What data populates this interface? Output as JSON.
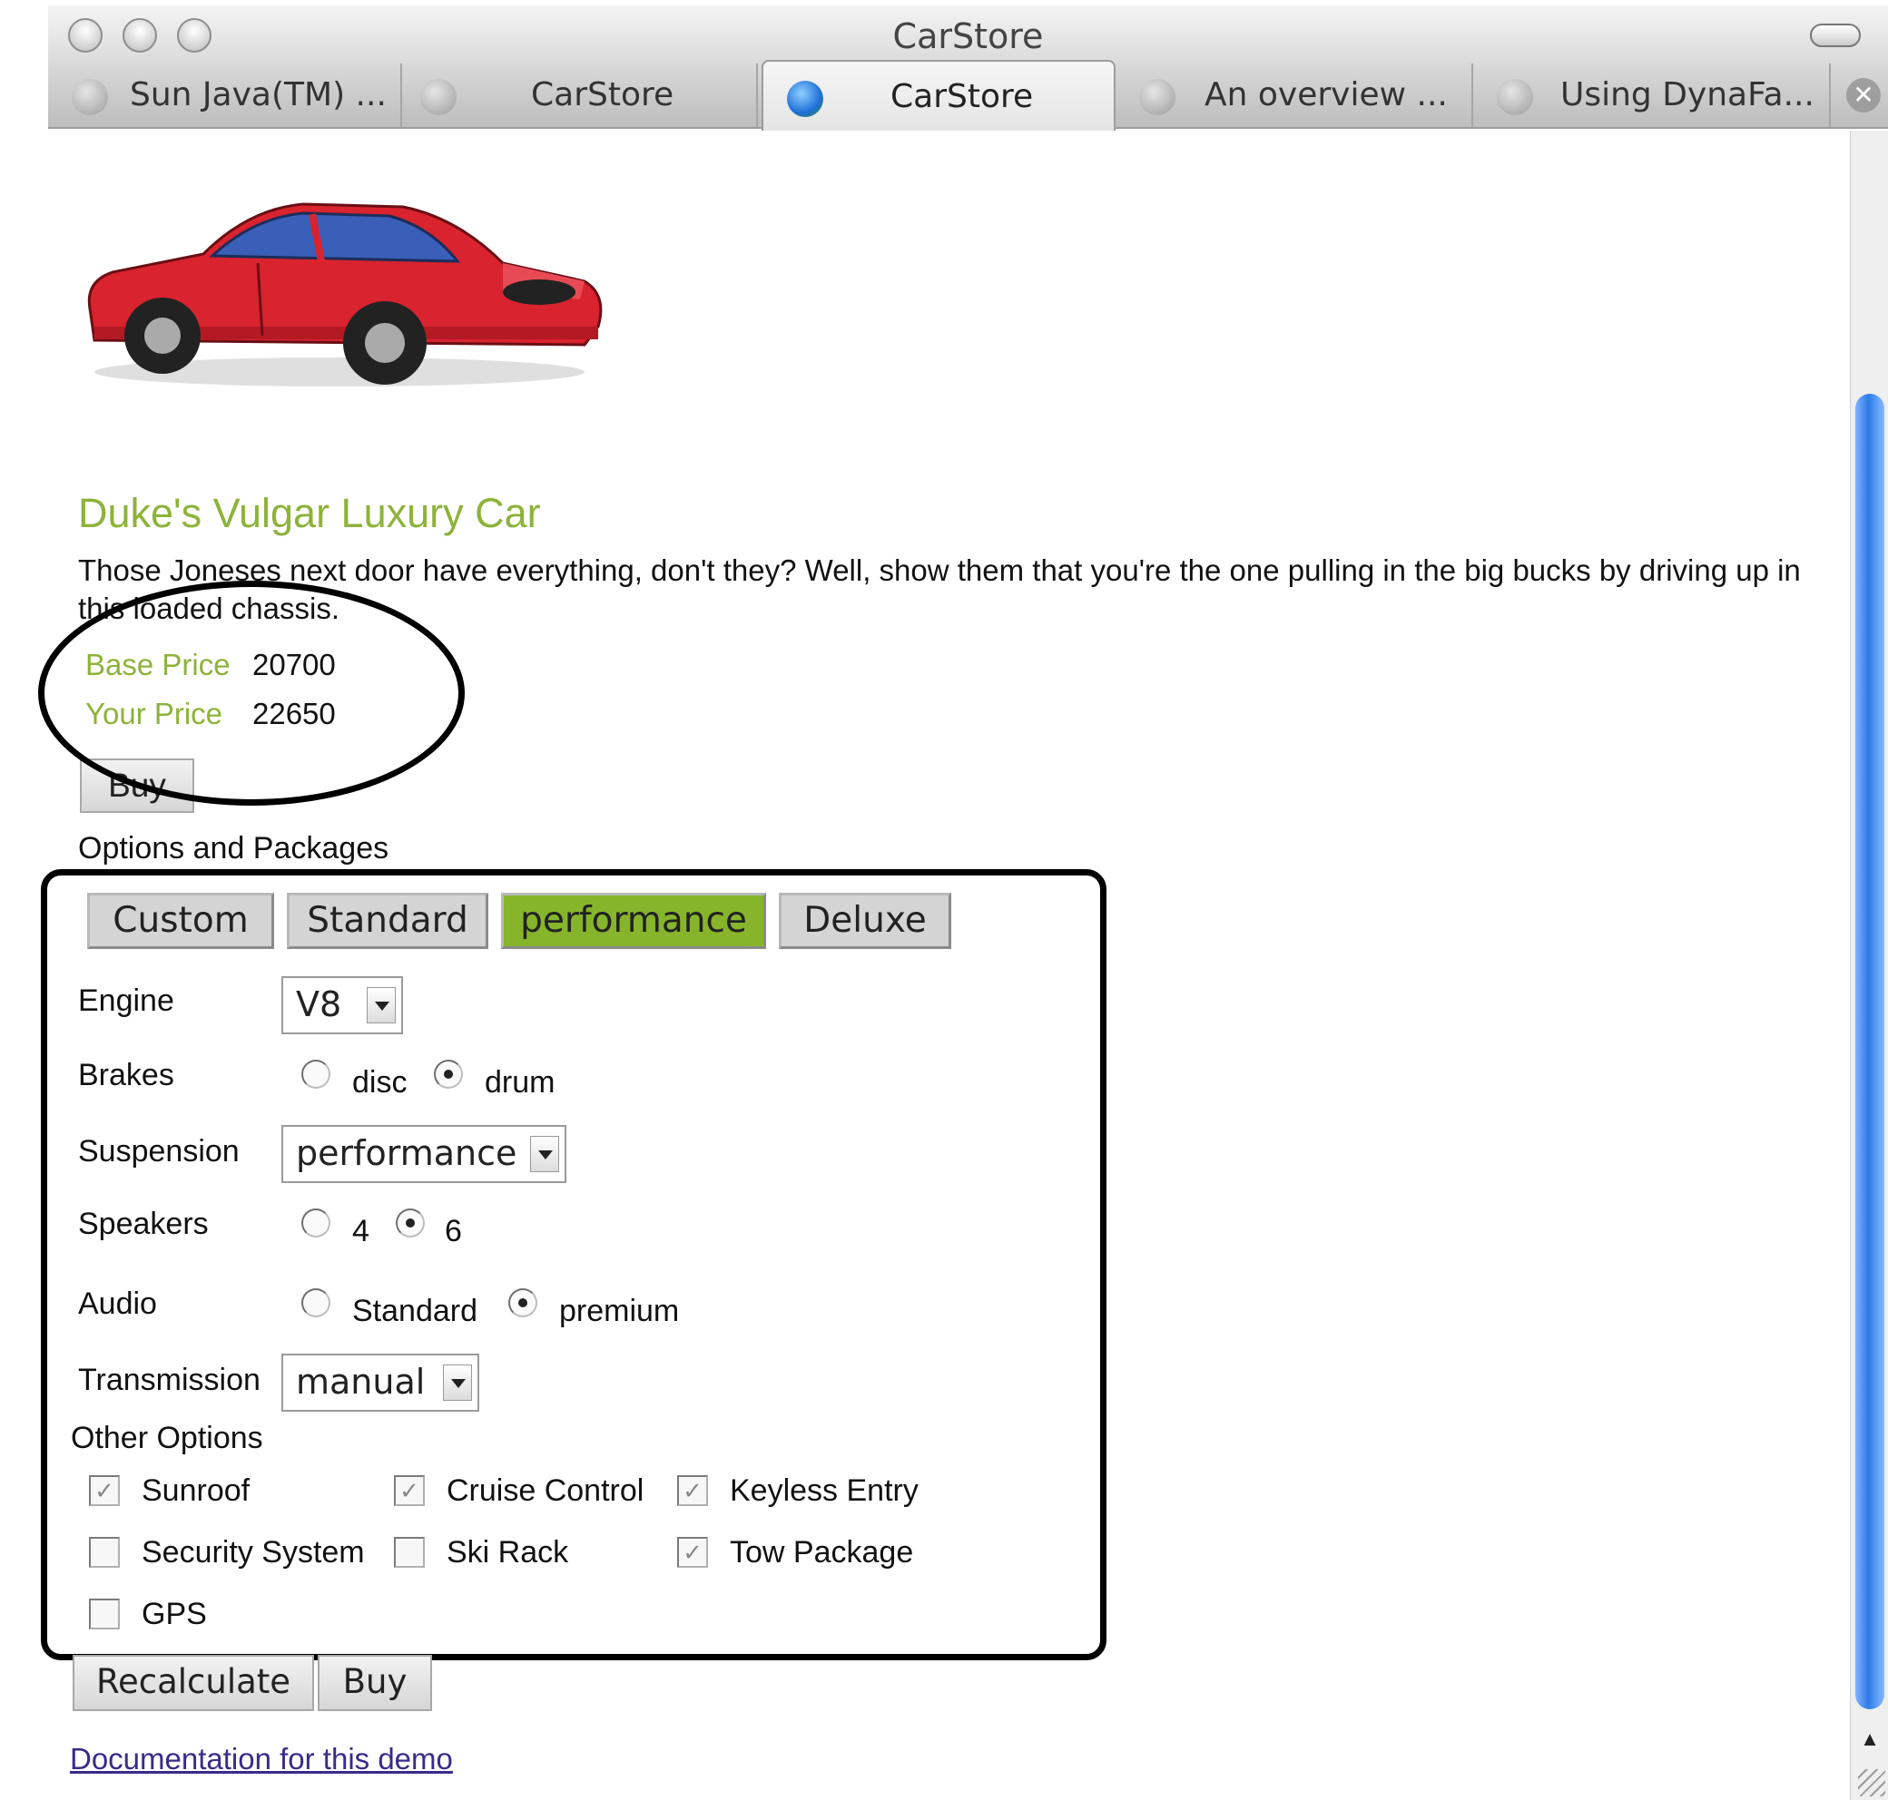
{
  "window": {
    "title": "CarStore"
  },
  "tabs": [
    {
      "label": "Sun Java(TM) ...",
      "active": false
    },
    {
      "label": "CarStore",
      "active": false
    },
    {
      "label": "CarStore",
      "active": true
    },
    {
      "label": "An overview ...",
      "active": false
    },
    {
      "label": "Using DynaFa...",
      "active": false
    }
  ],
  "car": {
    "title": "Duke's Vulgar Luxury Car",
    "description": "Those Joneses next door have everything, don't they? Well, show them that you're the one pulling in the big bucks by driving up in this loaded chassis.",
    "base_price_label": "Base Price",
    "base_price": "20700",
    "your_price_label": "Your Price",
    "your_price": "22650",
    "buy_label": "Buy"
  },
  "options": {
    "heading": "Options and Packages",
    "packages": [
      {
        "label": "Custom",
        "selected": false
      },
      {
        "label": "Standard",
        "selected": false
      },
      {
        "label": "performance",
        "selected": true
      },
      {
        "label": "Deluxe",
        "selected": false
      }
    ],
    "engine": {
      "label": "Engine",
      "value": "V8"
    },
    "brakes": {
      "label": "Brakes",
      "options": [
        {
          "label": "disc",
          "checked": false
        },
        {
          "label": "drum",
          "checked": true
        }
      ]
    },
    "suspension": {
      "label": "Suspension",
      "value": "performance"
    },
    "speakers": {
      "label": "Speakers",
      "options": [
        {
          "label": "4",
          "checked": false
        },
        {
          "label": "6",
          "checked": true
        }
      ]
    },
    "audio": {
      "label": "Audio",
      "options": [
        {
          "label": "Standard",
          "checked": false
        },
        {
          "label": "premium",
          "checked": true
        }
      ]
    },
    "transmission": {
      "label": "Transmission",
      "value": "manual"
    },
    "other_heading": "Other Options",
    "other": [
      {
        "label": "Sunroof",
        "checked": true
      },
      {
        "label": "Cruise Control",
        "checked": true
      },
      {
        "label": "Keyless Entry",
        "checked": true
      },
      {
        "label": "Security System",
        "checked": false
      },
      {
        "label": "Ski Rack",
        "checked": false
      },
      {
        "label": "Tow Package",
        "checked": true
      },
      {
        "label": "GPS",
        "checked": false
      }
    ],
    "recalculate_label": "Recalculate",
    "buy_label": "Buy"
  },
  "doc_link": "Documentation for this demo",
  "colors": {
    "accent_green": "#8db33a",
    "selected_package": "#86b52b",
    "link": "#3a2b8a"
  }
}
